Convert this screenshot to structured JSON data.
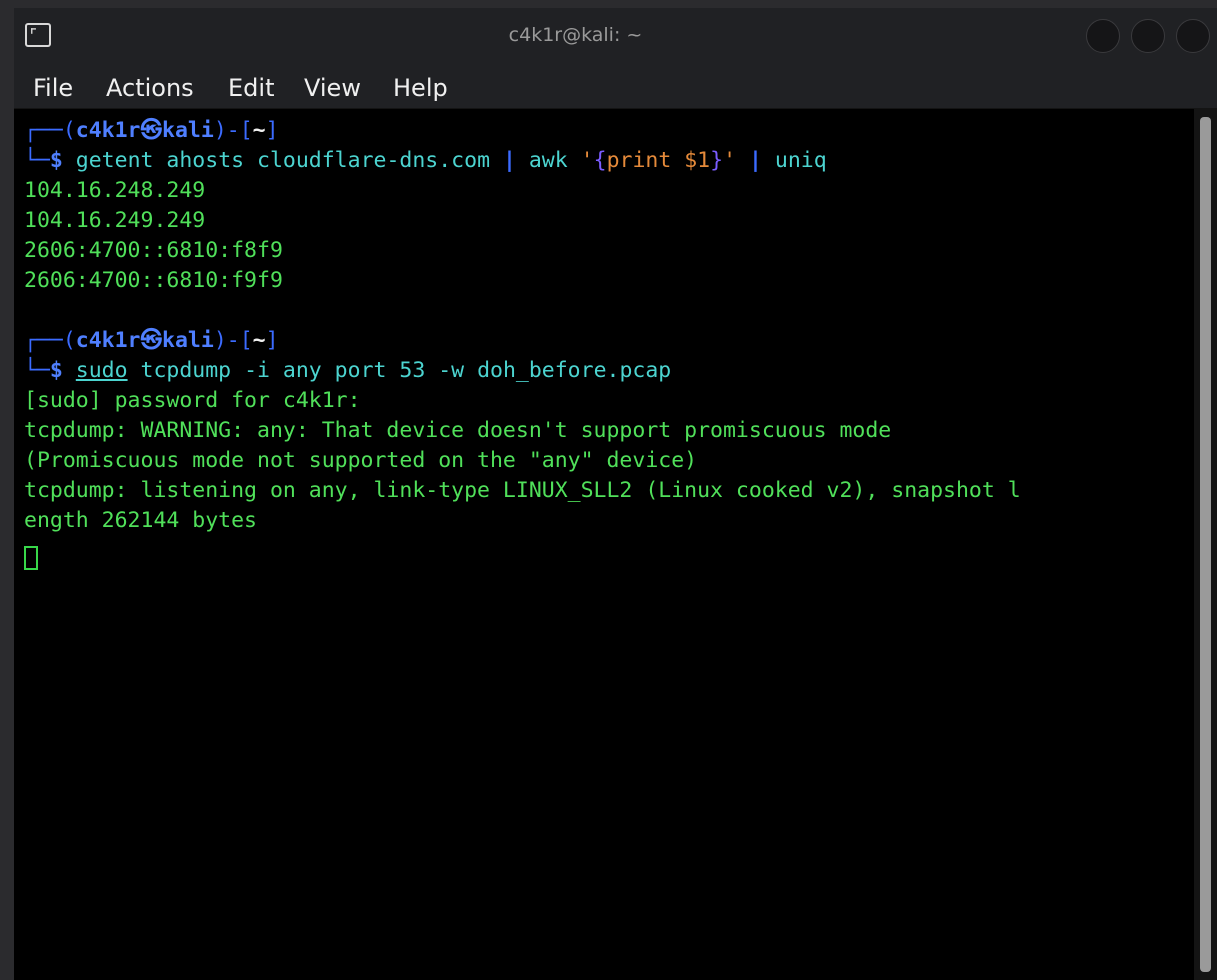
{
  "window": {
    "title": "c4k1r@kali: ~"
  },
  "menu": [
    "File",
    "Actions",
    "Edit",
    "View",
    "Help"
  ],
  "prompt": {
    "open": "┌──(",
    "user": "c4k1r",
    "at": "㉿",
    "host": "kali",
    "mid": ")-[",
    "dir": "~",
    "close": "]",
    "lower": "└─",
    "dollar": "$"
  },
  "command1": {
    "cmd": "getent",
    "args": " ahosts cloudflare-dns.com ",
    "pipe1": "|",
    "awk": " awk ",
    "q1": "'",
    "brace_open": "{",
    "print": "print $1",
    "brace_close": "}",
    "q2": "'",
    "pipe2": "|",
    "uniq": " uniq"
  },
  "output1": [
    "104.16.248.249",
    "104.16.249.249",
    "2606:4700::6810:f8f9",
    "2606:4700::6810:f9f9"
  ],
  "command2": {
    "sudo": "sudo",
    "rest": " tcpdump -i any port 53 -w doh_before.pcap"
  },
  "output2": [
    "[sudo] password for c4k1r:",
    "tcpdump: WARNING: any: That device doesn't support promiscuous mode",
    "(Promiscuous mode not supported on the \"any\" device)",
    "tcpdump: listening on any, link-type LINUX_SLL2 (Linux cooked v2), snapshot l",
    "ength 262144 bytes"
  ],
  "icons": {
    "app": "terminal-icon",
    "buttons": [
      "minimize-icon",
      "maximize-icon",
      "close-icon"
    ]
  },
  "colors": {
    "prompt_blue": "#3b6bff",
    "output_green": "#50e05a",
    "command_cyan": "#4cd4d0",
    "string_orange": "#e58a3a"
  }
}
